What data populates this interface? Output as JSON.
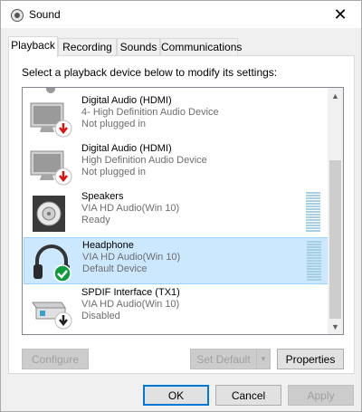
{
  "window": {
    "title": "Sound",
    "close_glyph": "✕"
  },
  "tabs": [
    {
      "label": "Playback",
      "active": true
    },
    {
      "label": "Recording",
      "active": false
    },
    {
      "label": "Sounds",
      "active": false
    },
    {
      "label": "Communications",
      "active": false
    }
  ],
  "instruction": "Select a playback device below to modify its settings:",
  "devices": [
    {
      "name": "Digital Audio (HDMI)",
      "driver": "4- High Definition Audio Device",
      "status": "Not plugged in",
      "icon": "monitor-icon",
      "badge": "red-down-arrow",
      "selected": false
    },
    {
      "name": "Digital Audio (HDMI)",
      "driver": "High Definition Audio Device",
      "status": "Not plugged in",
      "icon": "monitor-icon",
      "badge": "red-down-arrow",
      "selected": false
    },
    {
      "name": "Speakers",
      "driver": "VIA HD Audio(Win 10)",
      "status": "Ready",
      "icon": "speaker-icon",
      "badge": "",
      "selected": false
    },
    {
      "name": "Headphone",
      "driver": "VIA HD Audio(Win 10)",
      "status": "Default Device",
      "icon": "headphone-icon",
      "badge": "green-check",
      "selected": true
    },
    {
      "name": "SPDIF Interface (TX1)",
      "driver": "VIA HD Audio(Win 10)",
      "status": "Disabled",
      "icon": "spdif-icon",
      "badge": "black-down-arrow",
      "selected": false
    }
  ],
  "buttons": {
    "configure": "Configure",
    "set_default": "Set Default",
    "properties": "Properties",
    "ok": "OK",
    "cancel": "Cancel",
    "apply": "Apply"
  },
  "colors": {
    "selection": "#cce8ff",
    "selection_border": "#99d1ff",
    "accent": "#0078d7"
  }
}
